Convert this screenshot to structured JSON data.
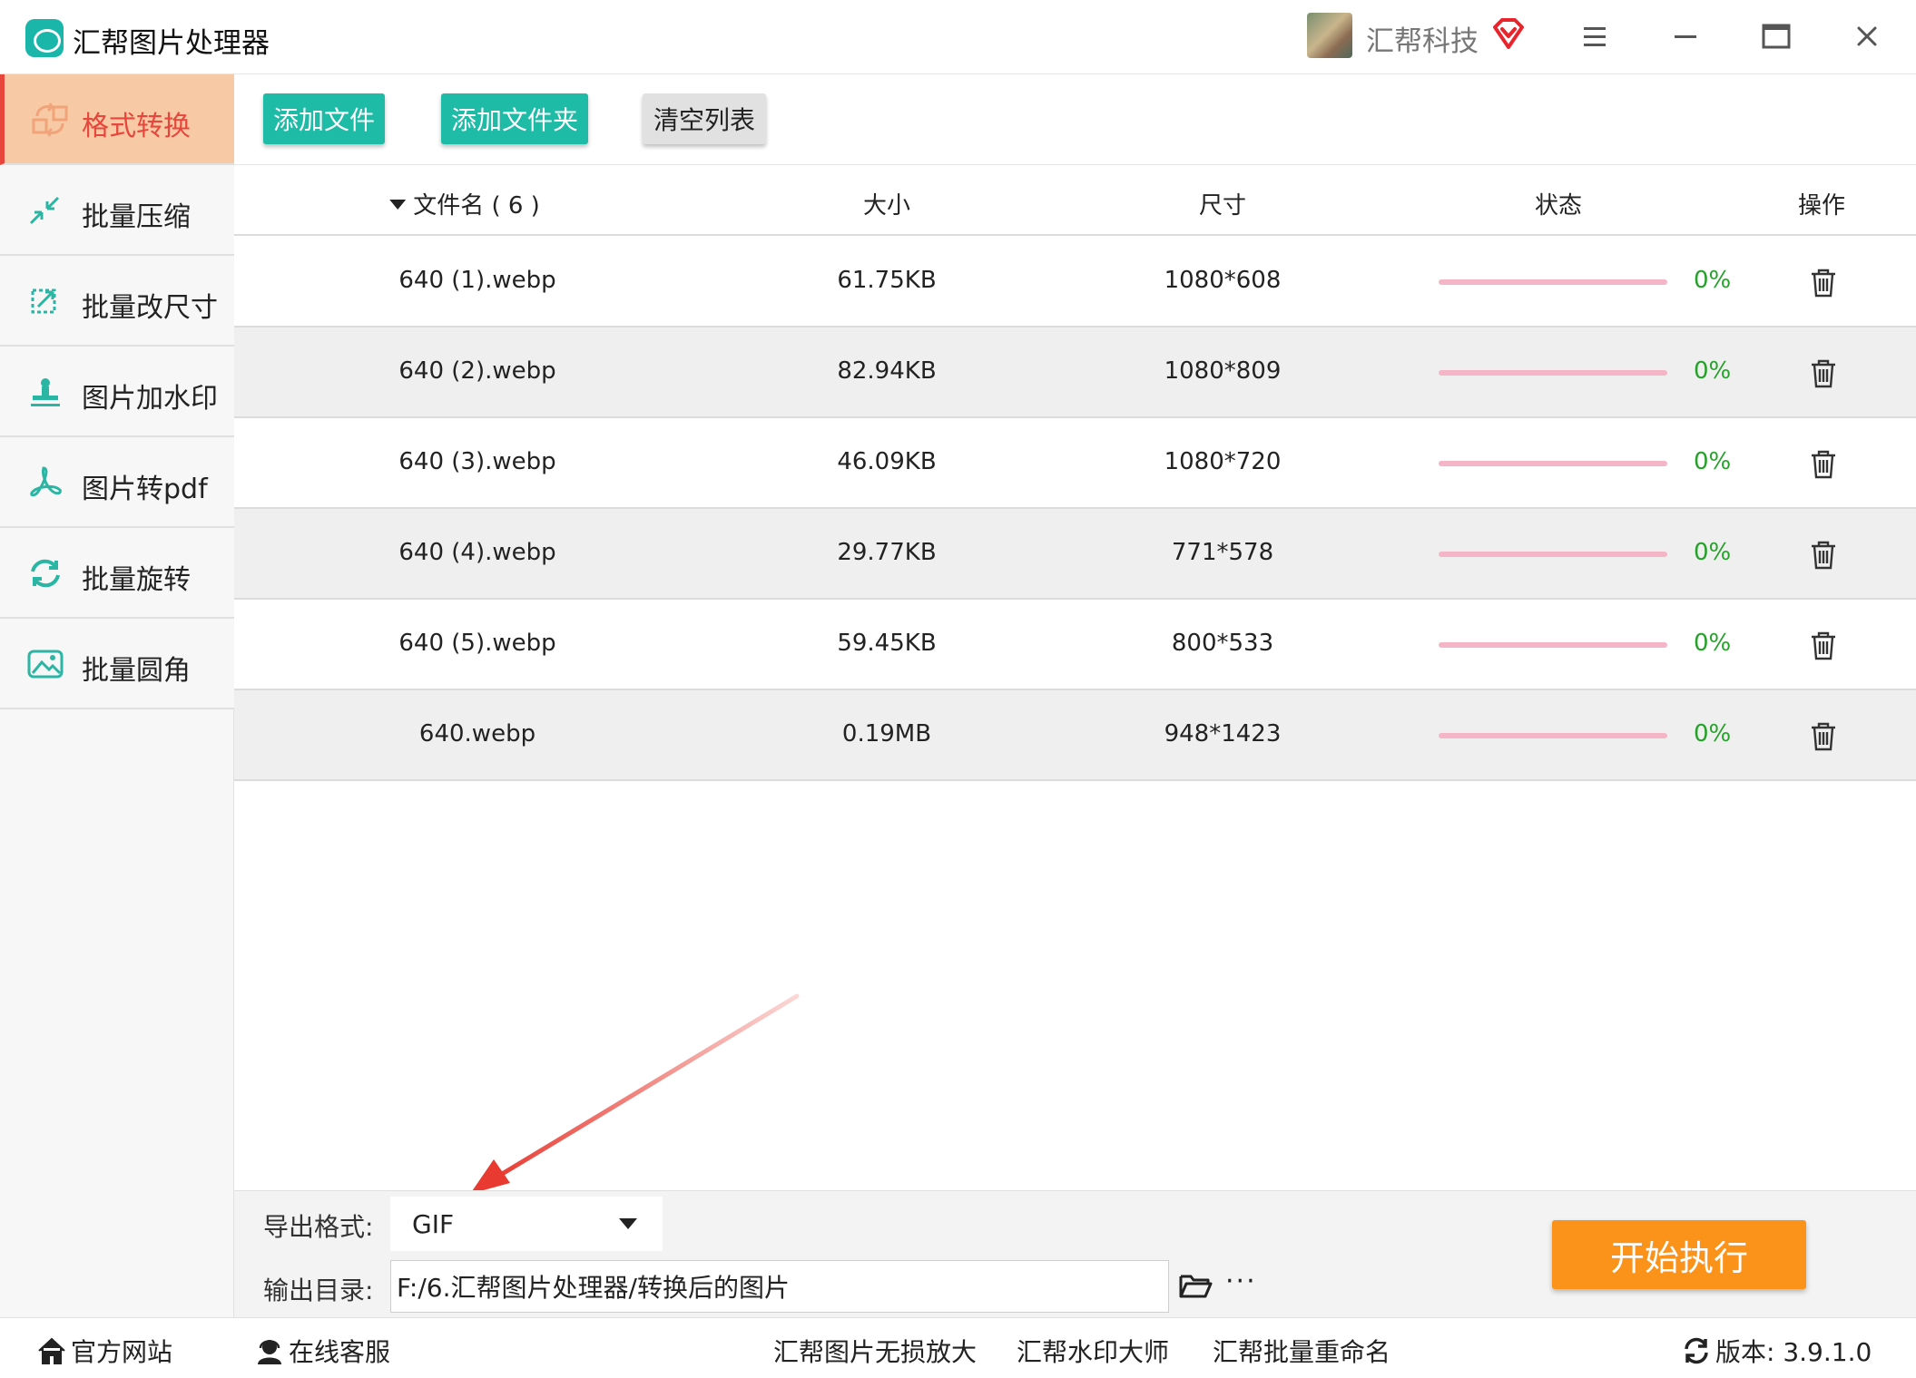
{
  "app": {
    "title": "汇帮图片处理器",
    "user_name": "汇帮科技"
  },
  "colors": {
    "accent_teal": "#1ebba6",
    "active_red": "#e8453c",
    "active_bg": "#f7c9a4",
    "start_orange": "#fb9219",
    "progress_pink": "#f4b5c6",
    "percent_green": "#25a229"
  },
  "sidebar": {
    "items": [
      {
        "label": "格式转换",
        "icon": "format-convert-icon",
        "active": true
      },
      {
        "label": "批量压缩",
        "icon": "compress-icon",
        "active": false
      },
      {
        "label": "批量改尺寸",
        "icon": "resize-icon",
        "active": false
      },
      {
        "label": "图片加水印",
        "icon": "watermark-icon",
        "active": false
      },
      {
        "label": "图片转pdf",
        "icon": "pdf-icon",
        "active": false
      },
      {
        "label": "批量旋转",
        "icon": "rotate-icon",
        "active": false
      },
      {
        "label": "批量圆角",
        "icon": "round-corner-icon",
        "active": false
      }
    ]
  },
  "toolbar": {
    "add_file": "添加文件",
    "add_folder": "添加文件夹",
    "clear_list": "清空列表"
  },
  "table": {
    "headers": {
      "name": "文件名 ( 6 )",
      "size": "大小",
      "dimensions": "尺寸",
      "status": "状态",
      "action": "操作"
    },
    "rows": [
      {
        "name": "640 (1).webp",
        "size": "61.75KB",
        "dimensions": "1080*608",
        "progress": 0,
        "percent": "0%"
      },
      {
        "name": "640 (2).webp",
        "size": "82.94KB",
        "dimensions": "1080*809",
        "progress": 0,
        "percent": "0%"
      },
      {
        "name": "640 (3).webp",
        "size": "46.09KB",
        "dimensions": "1080*720",
        "progress": 0,
        "percent": "0%"
      },
      {
        "name": "640 (4).webp",
        "size": "29.77KB",
        "dimensions": "771*578",
        "progress": 0,
        "percent": "0%"
      },
      {
        "name": "640 (5).webp",
        "size": "59.45KB",
        "dimensions": "800*533",
        "progress": 0,
        "percent": "0%"
      },
      {
        "name": "640.webp",
        "size": "0.19MB",
        "dimensions": "948*1423",
        "progress": 0,
        "percent": "0%"
      }
    ]
  },
  "settings": {
    "format_label": "导出格式:",
    "format_value": "GIF",
    "dir_label": "输出目录:",
    "dir_value": "F:/6.汇帮图片处理器/转换后的图片",
    "more": "···",
    "start": "开始执行"
  },
  "footer": {
    "website": "官方网站",
    "support": "在线客服",
    "link1": "汇帮图片无损放大",
    "link2": "汇帮水印大师",
    "link3": "汇帮批量重命名",
    "version": "版本: 3.9.1.0"
  }
}
